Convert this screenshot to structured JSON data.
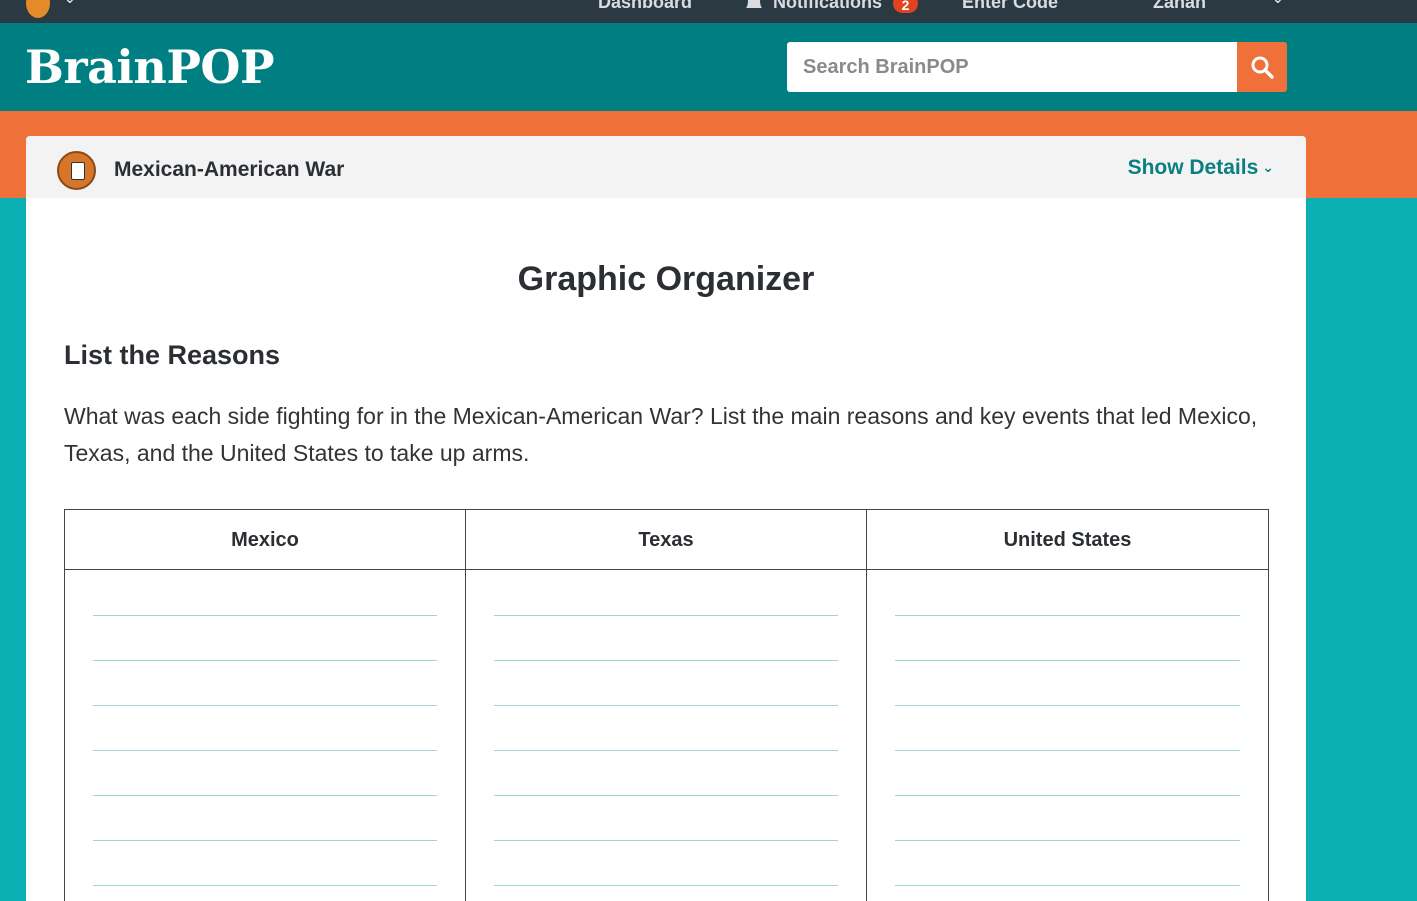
{
  "topbar": {
    "dashboard": "Dashboard",
    "notifications": "Notifications",
    "notification_count": "2",
    "enter_code": "Enter Code",
    "user": "Zahan"
  },
  "header": {
    "logo": "BrainPOP",
    "search_placeholder": "Search BrainPOP"
  },
  "topic": {
    "title": "Mexican-American War",
    "show_details": "Show Details"
  },
  "organizer": {
    "title": "Graphic Organizer",
    "section_title": "List the Reasons",
    "prompt": "What was each side fighting for in the Mexican-American War? List the main reasons and key events that led Mexico, Texas, and the United States to take up arms.",
    "columns": [
      "Mexico",
      "Texas",
      "United States"
    ]
  }
}
